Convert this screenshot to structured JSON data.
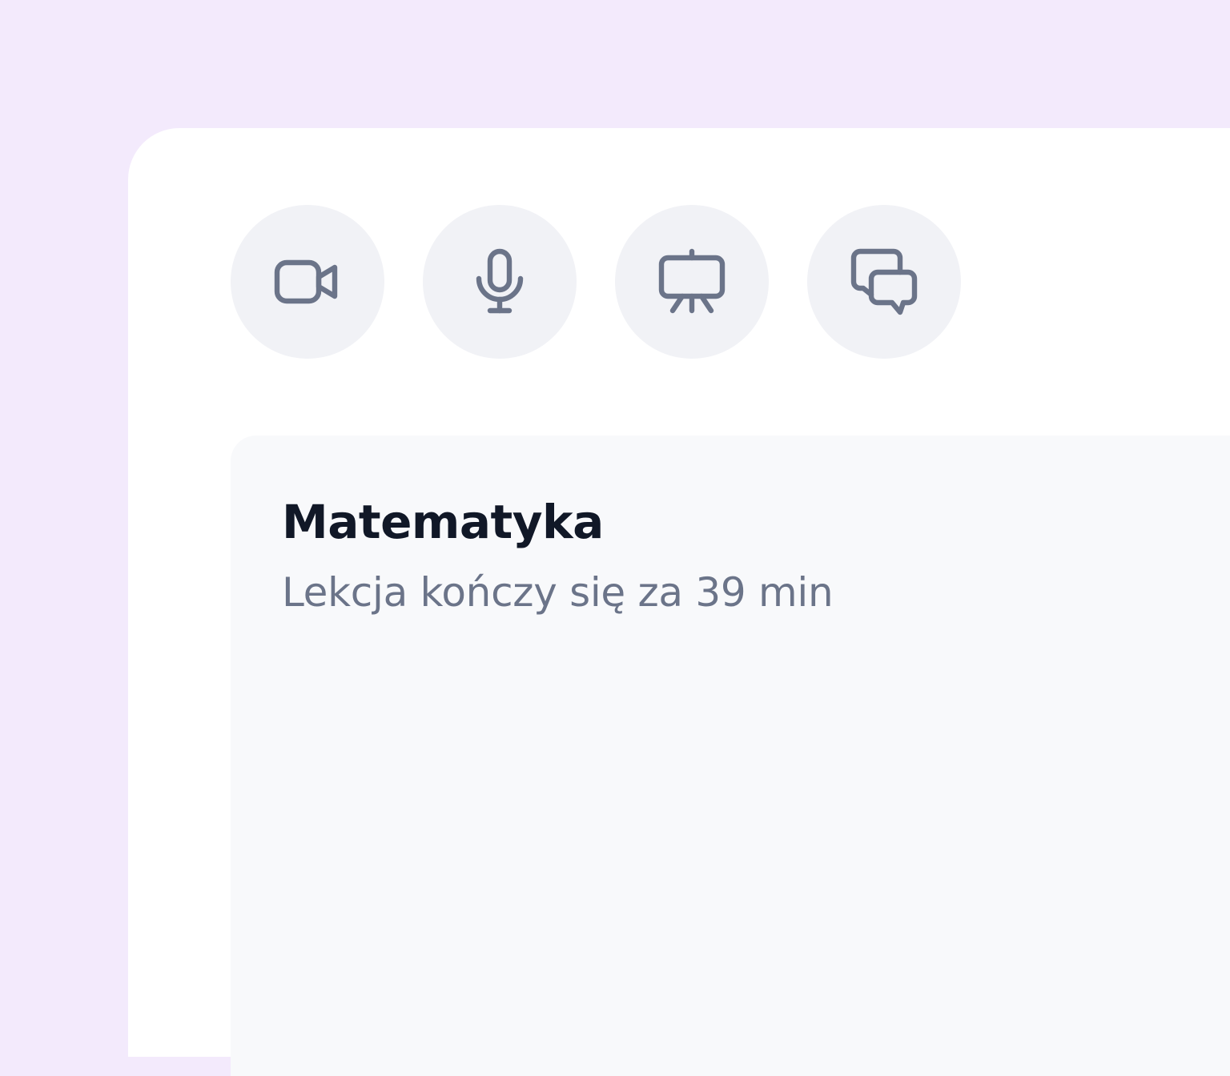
{
  "toolbar": {
    "buttons": [
      {
        "icon": "video-camera-icon"
      },
      {
        "icon": "microphone-icon"
      },
      {
        "icon": "presentation-board-icon"
      },
      {
        "icon": "chat-bubbles-icon"
      }
    ]
  },
  "lesson": {
    "title": "Matematyka",
    "status": "Lekcja kończy się za 39 min"
  },
  "colors": {
    "page_background": "#f3eafc",
    "window_background": "#ffffff",
    "button_background": "#f1f2f6",
    "card_background": "#f8f9fb",
    "icon_stroke": "#6b7489",
    "title_text": "#111827",
    "status_text": "#6b7489"
  }
}
